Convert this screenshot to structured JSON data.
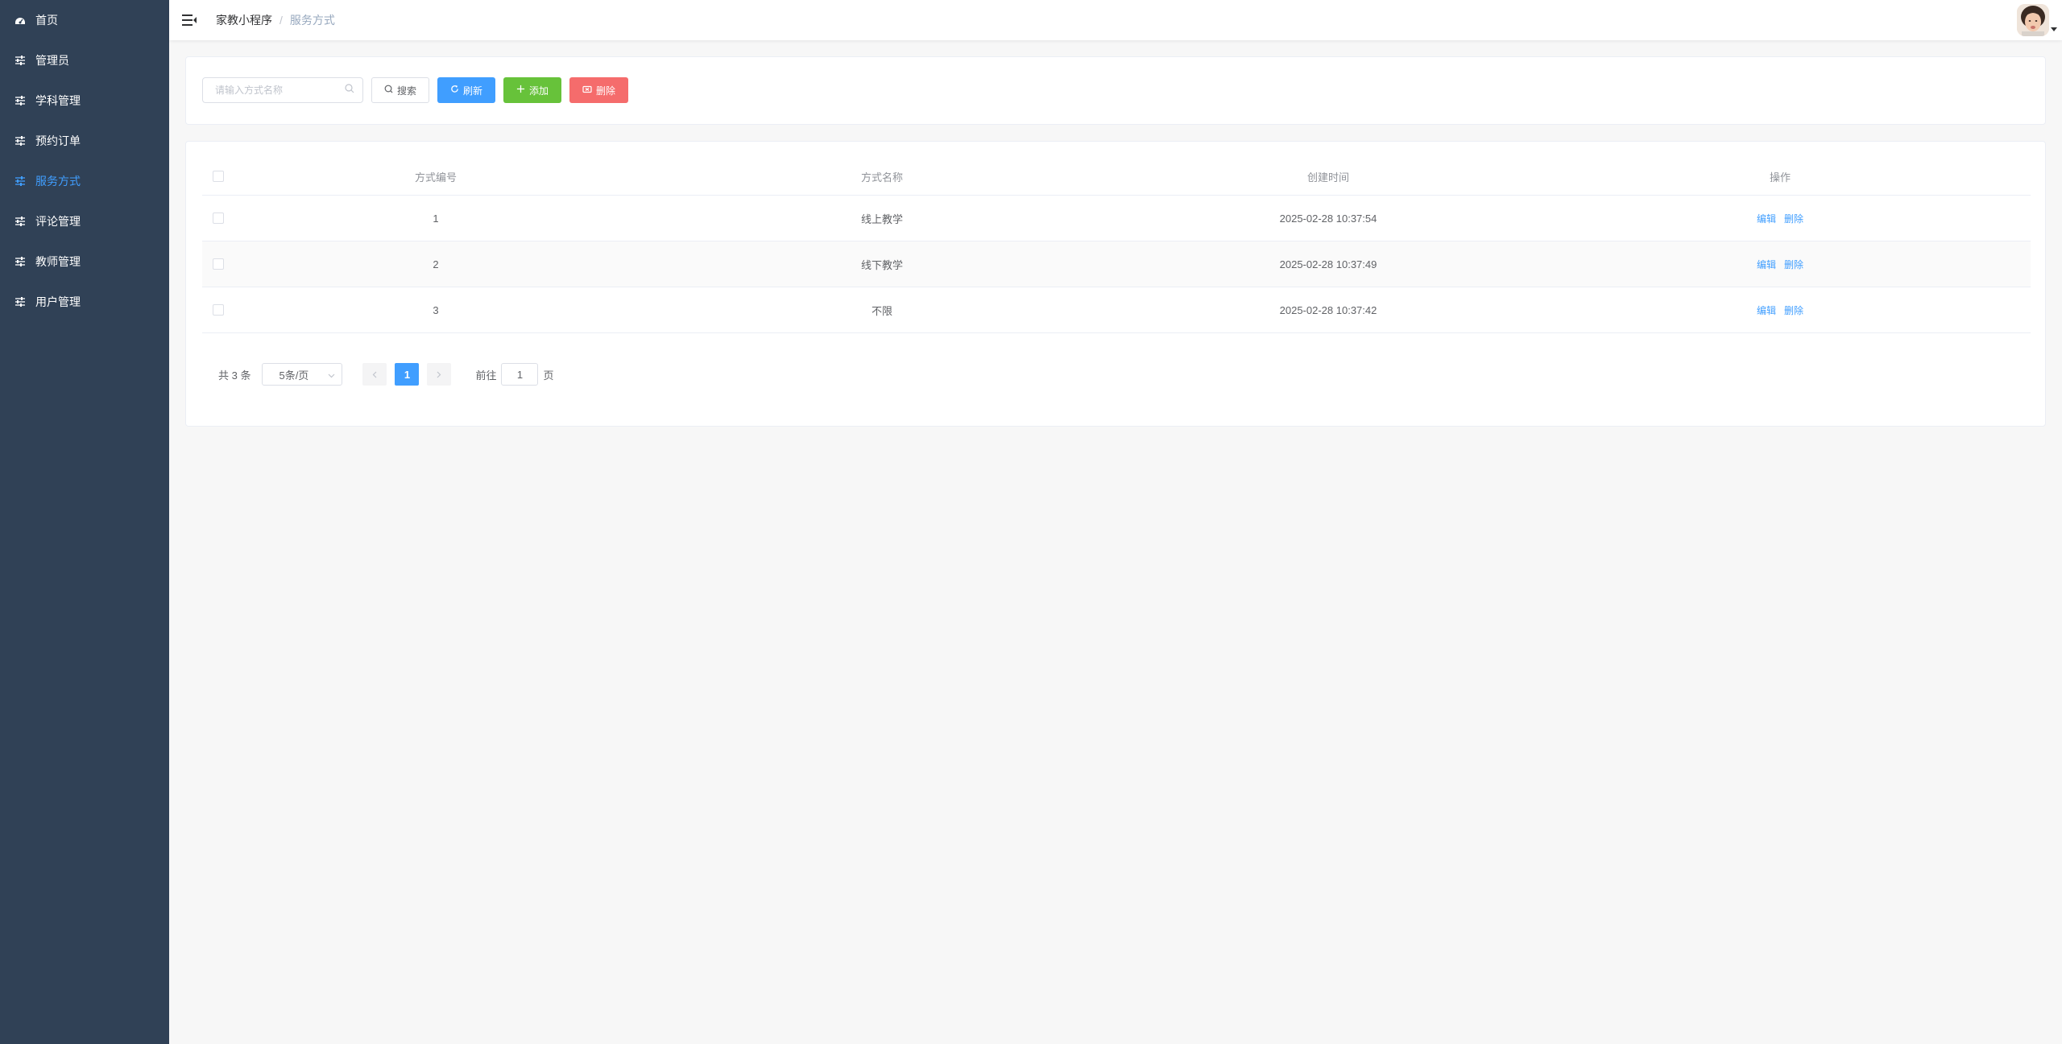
{
  "sidebar": {
    "items": [
      {
        "label": "首页",
        "icon": "dashboard-icon",
        "active": false
      },
      {
        "label": "管理员",
        "icon": "sliders-icon",
        "active": false
      },
      {
        "label": "学科管理",
        "icon": "sliders-icon",
        "active": false
      },
      {
        "label": "预约订单",
        "icon": "sliders-icon",
        "active": false
      },
      {
        "label": "服务方式",
        "icon": "sliders-icon",
        "active": true
      },
      {
        "label": "评论管理",
        "icon": "sliders-icon",
        "active": false
      },
      {
        "label": "教师管理",
        "icon": "sliders-icon",
        "active": false
      },
      {
        "label": "用户管理",
        "icon": "sliders-icon",
        "active": false
      }
    ]
  },
  "header": {
    "breadcrumb_root": "家教小程序",
    "breadcrumb_sep": "/",
    "breadcrumb_current": "服务方式"
  },
  "toolbar": {
    "search_placeholder": "请输入方式名称",
    "search_label": "搜索",
    "refresh_label": "刷新",
    "add_label": "添加",
    "delete_label": "删除"
  },
  "table": {
    "columns": [
      "方式编号",
      "方式名称",
      "创建时间",
      "操作"
    ],
    "rows": [
      {
        "id": "1",
        "name": "线上教学",
        "created": "2025-02-28 10:37:54",
        "edit": "编辑",
        "delete": "删除"
      },
      {
        "id": "2",
        "name": "线下教学",
        "created": "2025-02-28 10:37:49",
        "edit": "编辑",
        "delete": "删除"
      },
      {
        "id": "3",
        "name": "不限",
        "created": "2025-02-28 10:37:42",
        "edit": "编辑",
        "delete": "删除"
      }
    ]
  },
  "pagination": {
    "total": "共 3 条",
    "page_size": "5条/页",
    "current_page": "1",
    "goto_label": "前往",
    "goto_value": "1",
    "page_suffix": "页"
  },
  "colors": {
    "sidebar_bg": "#304156",
    "accent": "#409eff",
    "success": "#67c23a",
    "danger": "#f56c6c"
  }
}
